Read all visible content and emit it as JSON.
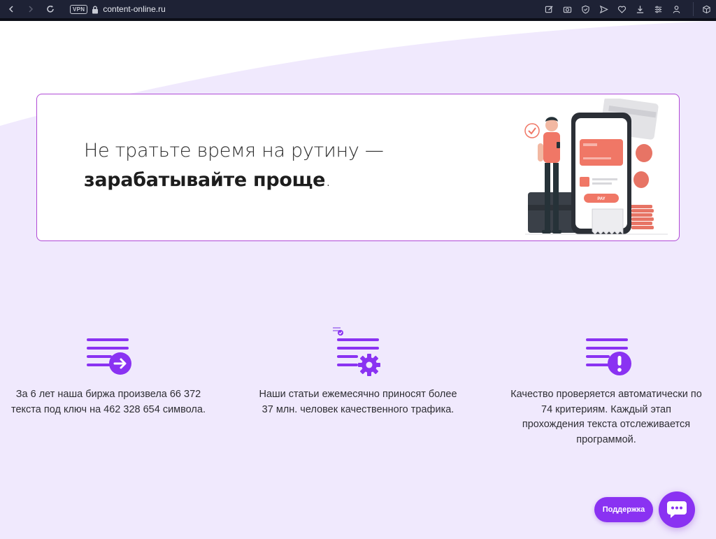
{
  "browser": {
    "vpn_label": "VPN",
    "url": "content-online.ru"
  },
  "hero": {
    "line1": "Не тратьте время на рутину —",
    "line2_bold": "зарабатывайте проще",
    "line2_tail": ".",
    "illustration_pay_label": "PAY"
  },
  "features": [
    {
      "icon": "document-arrow-icon",
      "text": "За 6 лет наша биржа произвела 66 372 текста под ключ на 462 328 654 символа."
    },
    {
      "icon": "document-gear-icon",
      "text": "Наши статьи ежемесячно приносят более 37 млн. человек качественного трафика."
    },
    {
      "icon": "document-alert-icon",
      "text": "Качество проверяется автоматически по 74 критериям. Каждый этап прохождения текста отслеживается программой."
    }
  ],
  "support": {
    "button_label": "Поддержка"
  },
  "colors": {
    "accent": "#8a32f2",
    "card_border": "#b04ad6",
    "page_bg": "#f0e9fd",
    "illustration_coral": "#f07766"
  }
}
